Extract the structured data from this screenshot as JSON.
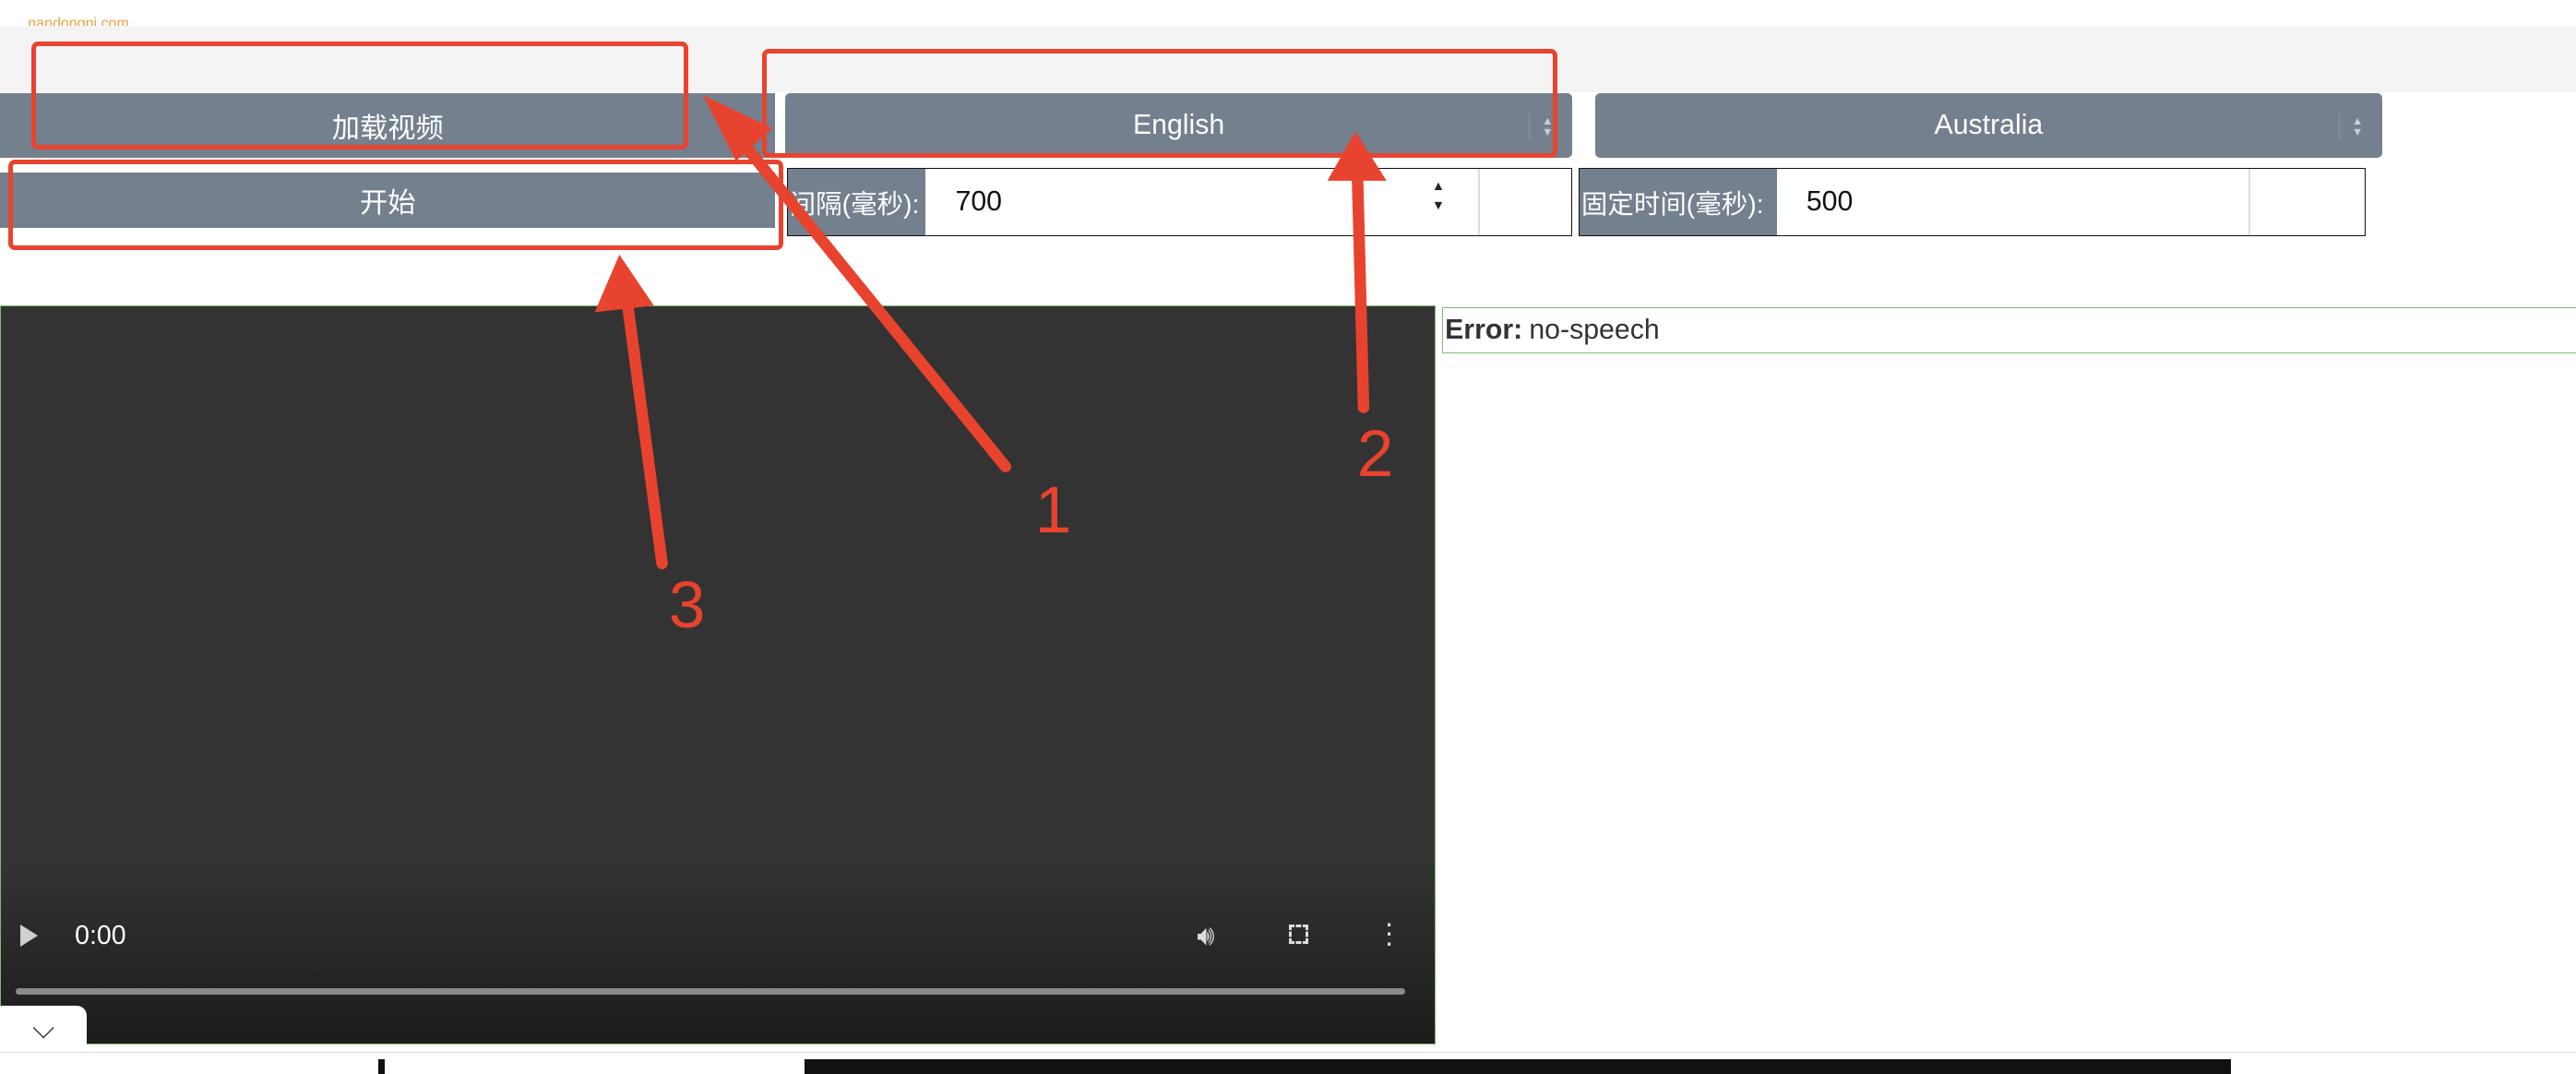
{
  "watermark": "nandongni.com",
  "toolbar": {
    "load_video_label": "加载视频",
    "start_label": "开始",
    "language_select": "English",
    "region_select": "Australia"
  },
  "fields": {
    "interval_label": "间隔(毫秒):",
    "interval_value": "700",
    "fixed_time_label": "固定时间(毫秒):",
    "fixed_time_value": "500"
  },
  "video": {
    "time": "0:00"
  },
  "output": {
    "error_label": "Error:",
    "error_message": "no-speech"
  },
  "annotations": {
    "n1": "1",
    "n2": "2",
    "n3": "3",
    "color": "#e8432e"
  },
  "colors": {
    "button_bg": "#74808d",
    "video_bg": "#333333",
    "border_green": "#7bbd6f"
  }
}
